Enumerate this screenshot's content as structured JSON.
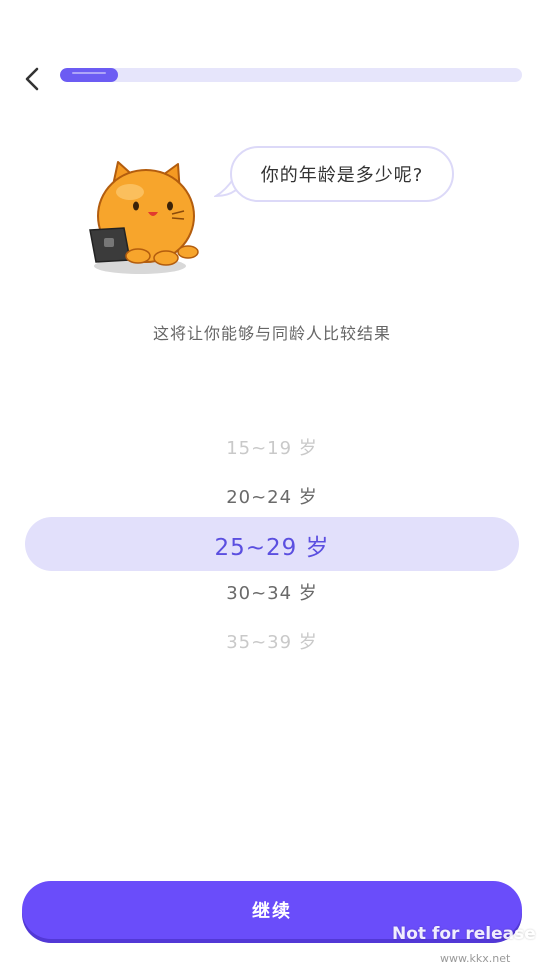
{
  "header": {
    "back_icon": "chevron-left-icon",
    "progress_fraction": 0.125,
    "accent_color": "#6a4dfa"
  },
  "mascot": {
    "icon": "orange-cat-with-laptop"
  },
  "question": {
    "text": "你的年龄是多少呢?"
  },
  "subtitle": {
    "text": "这将让你能够与同龄人比较结果"
  },
  "picker": {
    "items": [
      "15~19 岁",
      "20~24 岁",
      "25~29 岁",
      "30~34 岁",
      "35~39 岁"
    ],
    "selected": "25~29 岁"
  },
  "footer": {
    "continue_label": "继续"
  },
  "watermark": {
    "text": "Not for release",
    "site": "www.kkx.net"
  }
}
